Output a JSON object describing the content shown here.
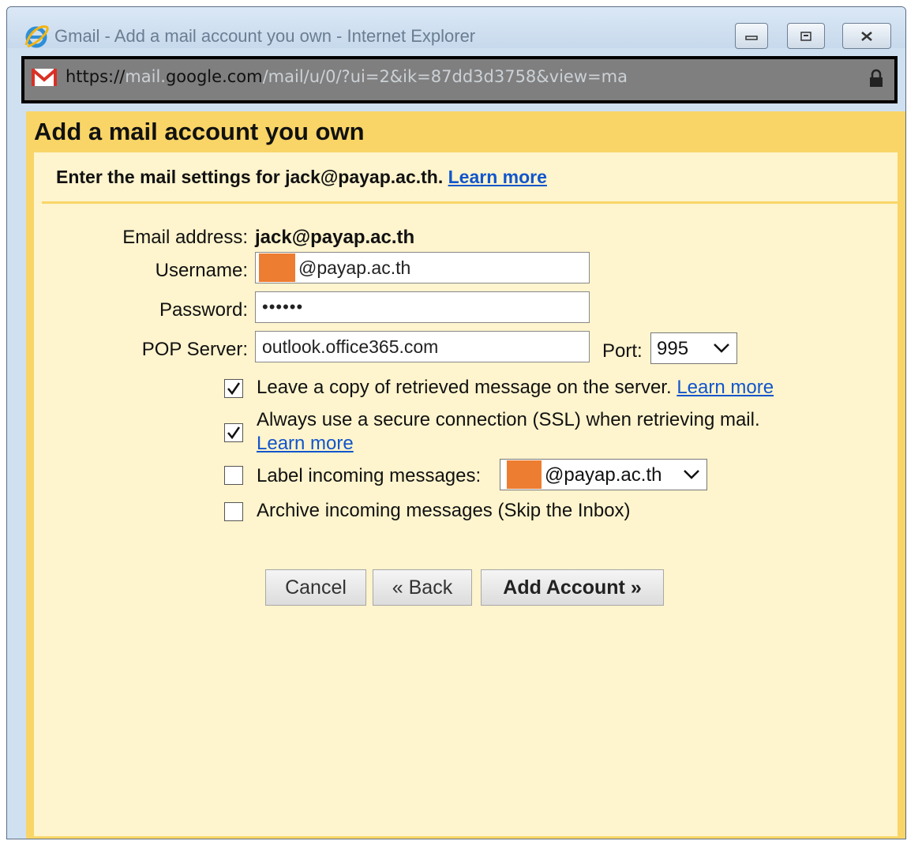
{
  "window": {
    "title": "Gmail - Add a mail account you own - Internet Explorer",
    "url_prefix": "https://",
    "url_domain_pre": "mail.",
    "url_domain": "google.com",
    "url_path": "/mail/u/0/?ui=2&ik=87dd3d3758&view=ma"
  },
  "dialog": {
    "title": "Add a mail account you own",
    "instruction": "Enter the mail settings for jack@payap.ac.th.",
    "learn_more": "Learn more",
    "email_label": "Email address:",
    "email_value": "jack@payap.ac.th",
    "username_label": "Username:",
    "username_value": "@payap.ac.th",
    "password_label": "Password:",
    "password_value": "••••••",
    "pop_label": "POP Server:",
    "pop_value": "outlook.office365.com",
    "port_label": "Port:",
    "port_value": "995",
    "options": {
      "leave_copy": {
        "label": "Leave a copy of retrieved message on the server.",
        "link": "Learn more",
        "checked": true
      },
      "ssl": {
        "label": "Always use a secure connection (SSL) when retrieving mail.",
        "link": "Learn more",
        "checked": true
      },
      "label_incoming": {
        "label": "Label incoming messages:",
        "value": "@payap.ac.th",
        "checked": false
      },
      "archive": {
        "label": "Archive incoming messages (Skip the Inbox)",
        "checked": false
      }
    },
    "buttons": {
      "cancel": "Cancel",
      "back": "« Back",
      "add": "Add Account »"
    }
  },
  "colors": {
    "dialog_border": "#f9d567",
    "dialog_body": "#fef4cd",
    "link": "#1155cc",
    "redaction": "#ed7d31"
  }
}
